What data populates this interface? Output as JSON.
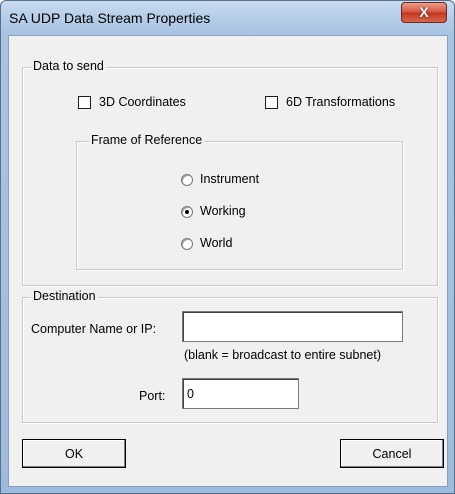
{
  "window": {
    "title": "SA UDP Data Stream Properties",
    "close_glyph": "X"
  },
  "data_to_send": {
    "legend": "Data to send",
    "coords_label": "3D Coordinates",
    "coords_checked": false,
    "transforms_label": "6D Transformations",
    "transforms_checked": false,
    "frame": {
      "legend": "Frame of Reference",
      "options": [
        {
          "label": "Instrument",
          "selected": false
        },
        {
          "label": "Working",
          "selected": true
        },
        {
          "label": "World",
          "selected": false
        }
      ]
    }
  },
  "destination": {
    "legend": "Destination",
    "computer_label": "Computer Name or IP:",
    "computer_value": "",
    "hint": "(blank = broadcast to entire subnet)",
    "port_label": "Port:",
    "port_value": "0"
  },
  "buttons": {
    "ok": "OK",
    "cancel": "Cancel"
  }
}
